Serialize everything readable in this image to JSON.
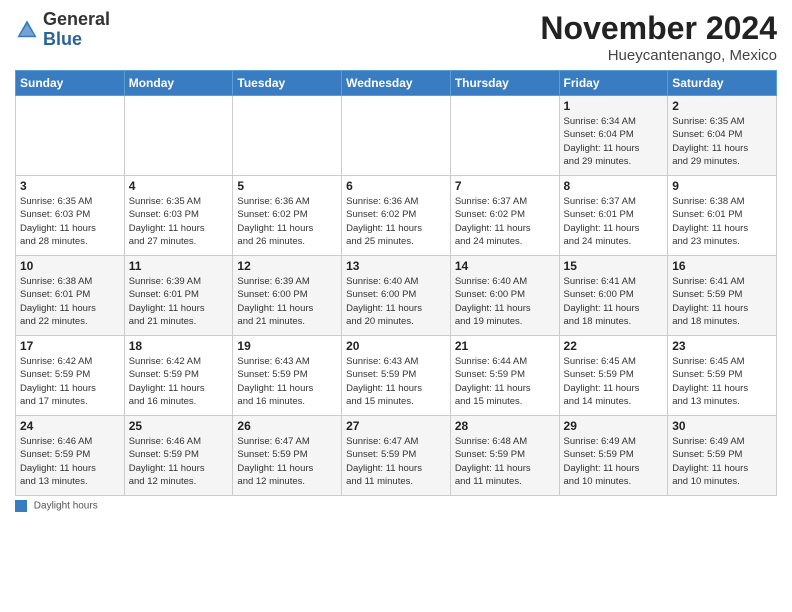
{
  "header": {
    "logo_general": "General",
    "logo_blue": "Blue",
    "month": "November 2024",
    "location": "Hueycantenango, Mexico"
  },
  "weekdays": [
    "Sunday",
    "Monday",
    "Tuesday",
    "Wednesday",
    "Thursday",
    "Friday",
    "Saturday"
  ],
  "weeks": [
    [
      {
        "day": "",
        "info": ""
      },
      {
        "day": "",
        "info": ""
      },
      {
        "day": "",
        "info": ""
      },
      {
        "day": "",
        "info": ""
      },
      {
        "day": "",
        "info": ""
      },
      {
        "day": "1",
        "info": "Sunrise: 6:34 AM\nSunset: 6:04 PM\nDaylight: 11 hours\nand 29 minutes."
      },
      {
        "day": "2",
        "info": "Sunrise: 6:35 AM\nSunset: 6:04 PM\nDaylight: 11 hours\nand 29 minutes."
      }
    ],
    [
      {
        "day": "3",
        "info": "Sunrise: 6:35 AM\nSunset: 6:03 PM\nDaylight: 11 hours\nand 28 minutes."
      },
      {
        "day": "4",
        "info": "Sunrise: 6:35 AM\nSunset: 6:03 PM\nDaylight: 11 hours\nand 27 minutes."
      },
      {
        "day": "5",
        "info": "Sunrise: 6:36 AM\nSunset: 6:02 PM\nDaylight: 11 hours\nand 26 minutes."
      },
      {
        "day": "6",
        "info": "Sunrise: 6:36 AM\nSunset: 6:02 PM\nDaylight: 11 hours\nand 25 minutes."
      },
      {
        "day": "7",
        "info": "Sunrise: 6:37 AM\nSunset: 6:02 PM\nDaylight: 11 hours\nand 24 minutes."
      },
      {
        "day": "8",
        "info": "Sunrise: 6:37 AM\nSunset: 6:01 PM\nDaylight: 11 hours\nand 24 minutes."
      },
      {
        "day": "9",
        "info": "Sunrise: 6:38 AM\nSunset: 6:01 PM\nDaylight: 11 hours\nand 23 minutes."
      }
    ],
    [
      {
        "day": "10",
        "info": "Sunrise: 6:38 AM\nSunset: 6:01 PM\nDaylight: 11 hours\nand 22 minutes."
      },
      {
        "day": "11",
        "info": "Sunrise: 6:39 AM\nSunset: 6:01 PM\nDaylight: 11 hours\nand 21 minutes."
      },
      {
        "day": "12",
        "info": "Sunrise: 6:39 AM\nSunset: 6:00 PM\nDaylight: 11 hours\nand 21 minutes."
      },
      {
        "day": "13",
        "info": "Sunrise: 6:40 AM\nSunset: 6:00 PM\nDaylight: 11 hours\nand 20 minutes."
      },
      {
        "day": "14",
        "info": "Sunrise: 6:40 AM\nSunset: 6:00 PM\nDaylight: 11 hours\nand 19 minutes."
      },
      {
        "day": "15",
        "info": "Sunrise: 6:41 AM\nSunset: 6:00 PM\nDaylight: 11 hours\nand 18 minutes."
      },
      {
        "day": "16",
        "info": "Sunrise: 6:41 AM\nSunset: 5:59 PM\nDaylight: 11 hours\nand 18 minutes."
      }
    ],
    [
      {
        "day": "17",
        "info": "Sunrise: 6:42 AM\nSunset: 5:59 PM\nDaylight: 11 hours\nand 17 minutes."
      },
      {
        "day": "18",
        "info": "Sunrise: 6:42 AM\nSunset: 5:59 PM\nDaylight: 11 hours\nand 16 minutes."
      },
      {
        "day": "19",
        "info": "Sunrise: 6:43 AM\nSunset: 5:59 PM\nDaylight: 11 hours\nand 16 minutes."
      },
      {
        "day": "20",
        "info": "Sunrise: 6:43 AM\nSunset: 5:59 PM\nDaylight: 11 hours\nand 15 minutes."
      },
      {
        "day": "21",
        "info": "Sunrise: 6:44 AM\nSunset: 5:59 PM\nDaylight: 11 hours\nand 15 minutes."
      },
      {
        "day": "22",
        "info": "Sunrise: 6:45 AM\nSunset: 5:59 PM\nDaylight: 11 hours\nand 14 minutes."
      },
      {
        "day": "23",
        "info": "Sunrise: 6:45 AM\nSunset: 5:59 PM\nDaylight: 11 hours\nand 13 minutes."
      }
    ],
    [
      {
        "day": "24",
        "info": "Sunrise: 6:46 AM\nSunset: 5:59 PM\nDaylight: 11 hours\nand 13 minutes."
      },
      {
        "day": "25",
        "info": "Sunrise: 6:46 AM\nSunset: 5:59 PM\nDaylight: 11 hours\nand 12 minutes."
      },
      {
        "day": "26",
        "info": "Sunrise: 6:47 AM\nSunset: 5:59 PM\nDaylight: 11 hours\nand 12 minutes."
      },
      {
        "day": "27",
        "info": "Sunrise: 6:47 AM\nSunset: 5:59 PM\nDaylight: 11 hours\nand 11 minutes."
      },
      {
        "day": "28",
        "info": "Sunrise: 6:48 AM\nSunset: 5:59 PM\nDaylight: 11 hours\nand 11 minutes."
      },
      {
        "day": "29",
        "info": "Sunrise: 6:49 AM\nSunset: 5:59 PM\nDaylight: 11 hours\nand 10 minutes."
      },
      {
        "day": "30",
        "info": "Sunrise: 6:49 AM\nSunset: 5:59 PM\nDaylight: 11 hours\nand 10 minutes."
      }
    ]
  ],
  "legend": {
    "daylight_label": "Daylight hours"
  }
}
